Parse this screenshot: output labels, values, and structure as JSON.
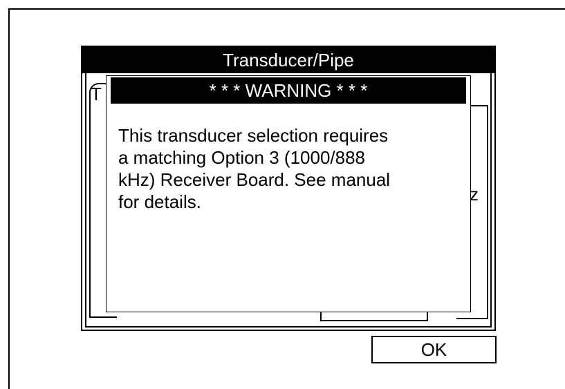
{
  "window": {
    "title": "Transducer/Pipe",
    "background_letters": {
      "tab_left": "T",
      "right_side": "z"
    }
  },
  "dialog": {
    "title": "* * * WARNING * * *",
    "message_lines": [
      "This transducer selection requires",
      "a matching Option 3 (1000/888",
      "kHz) Receiver Board. See manual",
      "for details."
    ]
  },
  "buttons": {
    "ok_label": "OK"
  },
  "colors": {
    "title_bar": "#000000",
    "title_text": "#ffffff",
    "background": "#ffffff"
  }
}
